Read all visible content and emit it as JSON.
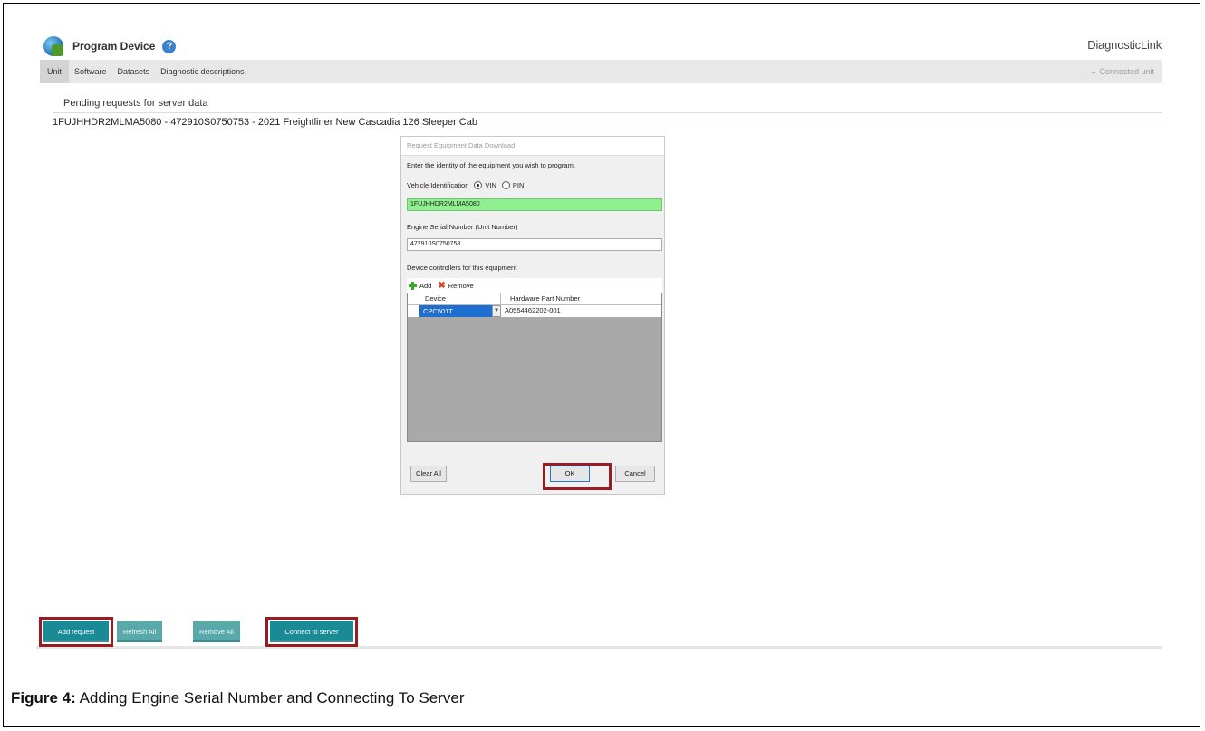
{
  "header": {
    "title": "Program Device",
    "help_glyph": "?",
    "brand": "DiagnosticLink"
  },
  "tabs": [
    "Unit",
    "Software",
    "Datasets",
    "Diagnostic descriptions"
  ],
  "status": {
    "connected": "→ Connected unit"
  },
  "pending": {
    "label": "Pending requests for server data",
    "row": "1FUJHHDR2MLMA5080 - 472910S0750753 - 2021 Freightliner New Cascadia 126 Sleeper Cab"
  },
  "dialog": {
    "title": "Request Equipment Data Download",
    "prompt": "Enter the identity of the equipment you wish to program.",
    "vehicle_label": "Vehicle Identification",
    "radio_vin": "VIN",
    "radio_pin": "PIN",
    "vin_value": "1FUJHHDR2MLMA5080",
    "esn_label": "Engine Serial Number (Unit Number)",
    "esn_value": "472910S0750753",
    "controllers_label": "Device controllers for this equipment",
    "add": "Add",
    "remove": "Remove",
    "col_device": "Device",
    "col_hw": "Hardware Part Number",
    "row_device": "CPC501T",
    "row_hw": "A0554462202-001",
    "clear_all": "Clear All",
    "ok": "OK",
    "cancel": "Cancel"
  },
  "buttons": {
    "add_request": "Add request",
    "refresh_all": "Refresh All",
    "remove_all": "Remove All",
    "connect": "Connect to server"
  },
  "caption": {
    "label": "Figure 4:",
    "text": " Adding Engine Serial Number and Connecting To Server"
  },
  "colors": {
    "accent_teal": "#1a8a96",
    "highlight_red": "#9b1b23",
    "vin_field_green": "#8ef08e"
  }
}
